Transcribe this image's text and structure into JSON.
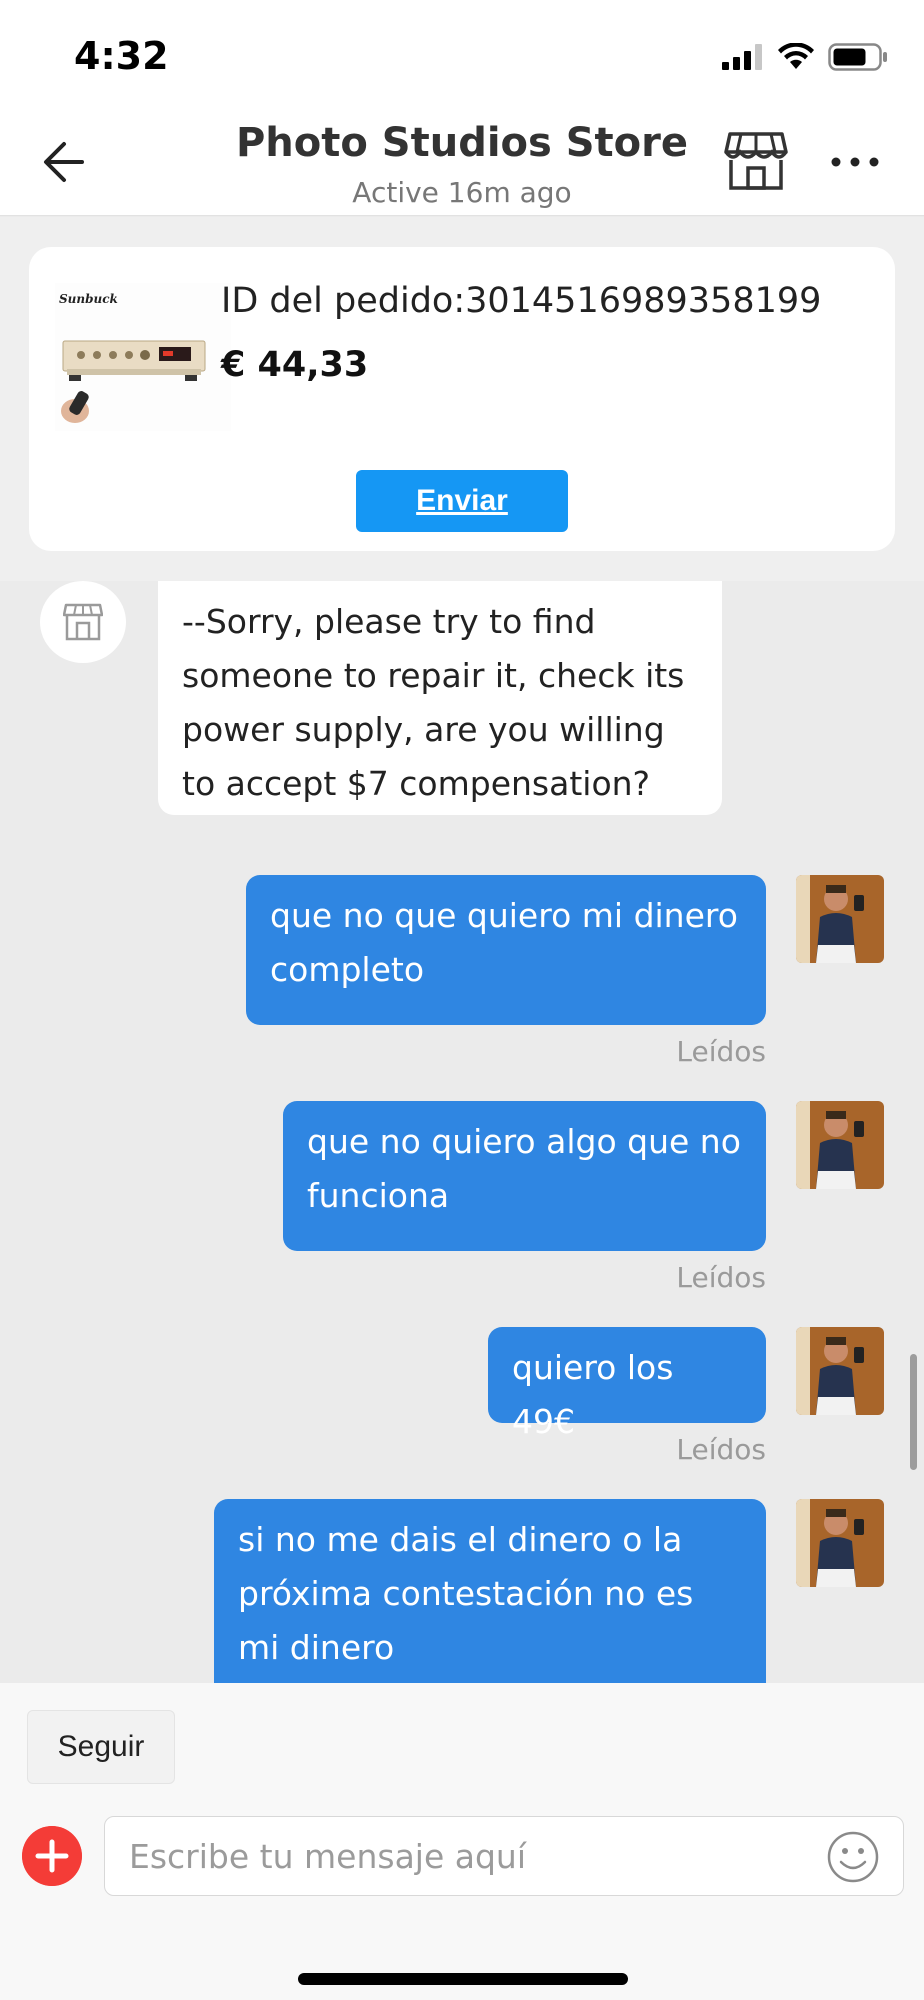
{
  "status_bar": {
    "time": "4:32"
  },
  "header": {
    "title": "Photo Studios Store",
    "subtitle": "Active 16m ago",
    "back_icon": "arrow-left-icon",
    "store_icon": "storefront-icon",
    "more_icon": "more-dots-icon"
  },
  "order": {
    "brand": "Sunbuck",
    "id_text": "ID del pedido:3014516989358199",
    "price": "€ 44,33",
    "send_label": "Enviar"
  },
  "messages": [
    {
      "from": "store",
      "text": "--Sorry, please try to find someone to repair it, check its power supply, are you willing to accept $7 compensation?"
    },
    {
      "from": "user",
      "text": "que no que quiero mi dinero completo",
      "status": "Leídos"
    },
    {
      "from": "user",
      "text": "que no quiero algo que no funciona",
      "status": "Leídos"
    },
    {
      "from": "user",
      "text": "quiero los 49€",
      "status": "Leídos"
    },
    {
      "from": "user",
      "text": "si no me dais el dinero o la próxima contestación no es mi dinero"
    }
  ],
  "footer": {
    "follow_label": "Seguir",
    "input_placeholder": "Escribe tu mensaje aquí",
    "plus_icon": "plus-icon",
    "emoji_icon": "emoji-smile-icon"
  },
  "colors": {
    "outgoing_bubble": "#2f86e2",
    "send_button": "#1597f4",
    "plus_button": "#f43c37"
  }
}
